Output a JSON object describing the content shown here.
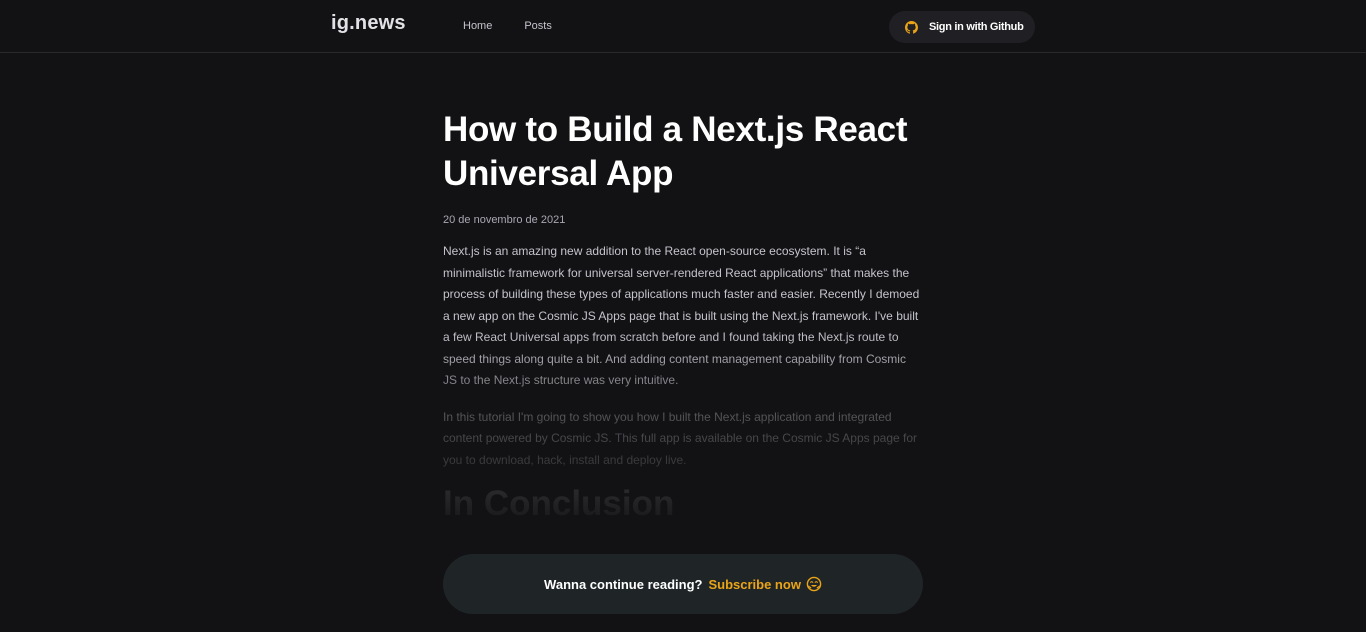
{
  "header": {
    "logo": "ig.news",
    "nav": [
      {
        "label": "Home"
      },
      {
        "label": "Posts"
      }
    ],
    "signin_label": "Sign in with Github",
    "signin_icon": "github-icon"
  },
  "article": {
    "title": "How to Build a Next.js React Universal App",
    "date": "20 de novembro de 2021",
    "paragraphs": [
      "Next.js is an amazing new addition to the React open-source ecosystem. It is “a minimalistic framework for universal server-rendered React applications” that makes the process of building these types of applications much faster and easier. Recently I demoed a new app on the Cosmic JS Apps page that is built using the Next.js framework. I've built a few React Universal apps from scratch before and I found taking the Next.js route to speed things along quite a bit. And adding content management capability from Cosmic JS to the Next.js structure was very intuitive.",
      "In this tutorial I'm going to show you how I built the Next.js application and integrated content powered by Cosmic JS. This full app is available on the Cosmic JS Apps page for you to download, hack, install and deploy live."
    ],
    "section_heading": "In Conclusion"
  },
  "subscribe": {
    "question": "Wanna continue reading?",
    "link": "Subscribe now",
    "icon": "hugging-face-emoji-icon"
  },
  "colors": {
    "background": "#121214",
    "accent": "#eba417",
    "pill": "#202024",
    "banner": "#1f2527"
  }
}
